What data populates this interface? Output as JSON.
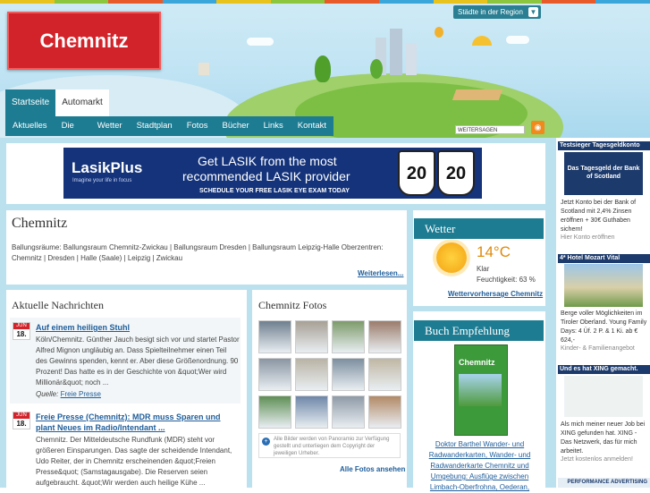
{
  "header": {
    "logo_text": "Chemnitz",
    "region_dropdown": "Städte in der Region",
    "tabs": [
      "Startseite",
      "Automarkt"
    ],
    "nav": [
      "Aktuelles",
      "Die Stadt",
      "Wetter",
      "Stadtplan",
      "Fotos",
      "Bücher",
      "Links",
      "Kontakt"
    ],
    "share_label": "WEITERSAGEN"
  },
  "banner": {
    "brand": "LasikPlus",
    "tagline": "Imagine your life in focus",
    "headline_1": "Get LASIK from the most",
    "headline_2": "recommended LASIK provider",
    "cta": "SCHEDULE YOUR FREE LASIK EYE EXAM TODAY",
    "shield_1": "20",
    "shield_2": "20"
  },
  "chemnitz": {
    "title": "Chemnitz",
    "text": "Ballungsräume:  Ballungsraum Chemnitz-Zwickau | Ballungsraum Dresden | Ballungsraum Leipzig-Halle Oberzentren: Chemnitz | Dresden | Halle (Saale) | Leipzig | Zwickau",
    "more": "Weiterlesen..."
  },
  "weather": {
    "title": "Wetter",
    "temp": "14°C",
    "condition": "Klar",
    "humidity": "Feuchtigkeit: 63 %",
    "link": "Wettervorhersage Chemnitz"
  },
  "news": {
    "title": "Aktuelle Nachrichten",
    "items": [
      {
        "month": "JUN",
        "day": "18.",
        "headline": "Auf einem heiligen Stuhl",
        "body": "Köln/Chemnitz. Günther Jauch besigt sich vor und startet Pastor Alfred Mignon ungläubig an. Dass Spielteilnehmer einen Teil des Gewinns spenden, kennt er. Aber diese Größenordnung. 90 Prozent! Das hatte es in der Geschichte von &quot;Wer wird Millionär&quot; noch ...",
        "source_label": "Quelle:",
        "source_link": "Freie Presse"
      },
      {
        "month": "JUN",
        "day": "18.",
        "headline": "Freie Presse (Chemnitz): MDR muss Sparen und plant Neues im Radio/Intendant ...",
        "body": "Chemnitz. Der Mitteldeutsche Rundfunk (MDR) steht vor größeren Einsparungen. Das sagte der scheidende Intendant, Udo Reiter, der in Chemnitz erscheinenden &quot;Freien Presse&quot; (Samstagausgabe). Die Reserven seien aufgebraucht. &quot;Wir werden auch heilige Kühe ..."
      }
    ]
  },
  "photos": {
    "title": "Chemnitz Fotos",
    "note": "Alle Bilder werden von Panoramio zur Verfügung gestellt und unterliegen dem Copyright der jeweiligen Urheber.",
    "all_link": "Alle Fotos ansehen",
    "thumb_colors": [
      "#6f7f8f",
      "#a7a095",
      "#7d9b6a",
      "#9b7c6a",
      "#8a96a3",
      "#b9b3a5",
      "#7d8fa0",
      "#c0b7a4",
      "#5f8f55",
      "#6e87a8",
      "#8f9aa8",
      "#b28a66"
    ]
  },
  "book": {
    "title": "Buch Empfehlung",
    "cover_title": "Chemnitz",
    "link": "Doktor Barthel Wander- und Radwanderkarten, Wander- und Radwanderkarte Chemnitz und Umgebung: Ausflüge zwischen Limbach-Oberfrohna, Oederan,"
  },
  "sidebar_ads": [
    {
      "header": "Testsieger Tagesgeldkonto",
      "image_text": "Das Tagesgeld der Bank of Scotland",
      "text": "Jetzt Konto bei der Bank of Scotland mit 2,4% Zinsen eröffnen + 30€ Guthaben sichern!",
      "sub": "Hier Konto eröffnen"
    },
    {
      "header": "4* Hotel Mozart Vital",
      "text": "Berge voller Möglichkeiten im Tiroler Oberland. Young Family Days: 4 Üf. 2 P. & 1 Ki. ab € 624,-",
      "sub": "Kinder- & Familienangebot"
    },
    {
      "header": "Und es hat XING gemacht.",
      "text": "Als mich meiner neuer Job bei XING gefunden hat. XING - Das Netzwerk, das für mich arbeitet.",
      "sub": "Jetzt kostenlos anmelden!"
    }
  ],
  "footer_ad": "PERFORMANCE ADVERTISING"
}
